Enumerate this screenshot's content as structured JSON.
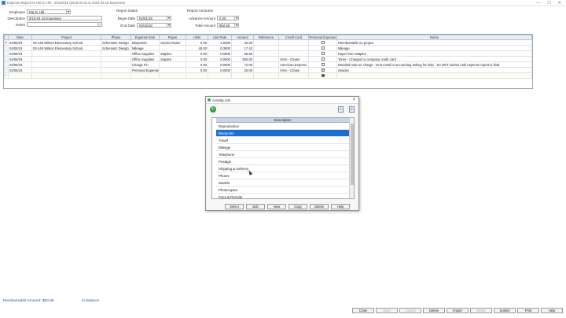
{
  "window": {
    "title": "Expense Report for Pat D. Hill - 4/15/2018 (2018-04-01 to 2018-04-15 Expenses)",
    "controls": [
      "—",
      "☐",
      "✕"
    ]
  },
  "header": {
    "employee_label": "Employee",
    "employee_value": "Pat D. Hill",
    "description_label": "Description",
    "description_value": "0/15-04-15 Expenses",
    "notes_label": "Notes",
    "notes_value": "",
    "report_dates_title": "Report Dates",
    "begin_date_label": "Begin Date",
    "begin_date_value": "04/01/18",
    "end_date_label": "End Date",
    "end_date_value": "04/15/18",
    "report_amounts_title": "Report Amounts",
    "advance_amount_label": "Advance Amount",
    "advance_amount_value": "0.00",
    "total_amount_label": "Total Amount",
    "total_amount_value": "952.56"
  },
  "grid": {
    "columns": [
      "Date",
      "Project",
      "Phase",
      "Expense Item",
      "Payee",
      "Units",
      "Unit Rate",
      "Amount",
      "Reference",
      "Credit Card",
      "Personal Expense",
      "Notes"
    ],
    "rows": [
      {
        "marker": "▸",
        "date": "04/05/18",
        "project": "03-145 Wilson Elementary School",
        "phase": "Schematic Design",
        "item": "Blueprints",
        "payee": "Vendor Name",
        "units": "0.00",
        "rate": "1.5000",
        "amount": "30.00",
        "reference": "",
        "card": "",
        "personal": "unchecked",
        "notes": "Reimbursable on project"
      },
      {
        "marker": "",
        "date": "04/05/18",
        "project": "03-145 Wilson Elementary School",
        "phase": "Schematic Design",
        "item": "Mileage",
        "payee": "",
        "units": "45.00",
        "rate": "0.3800",
        "amount": "17.10",
        "reference": "",
        "card": "",
        "personal": "unchecked",
        "notes": "Mileage"
      },
      {
        "marker": "",
        "date": "04/05/18",
        "project": "",
        "phase": "",
        "item": "Office Supplies",
        "payee": "Staples",
        "units": "0.00",
        "rate": "0.0000",
        "amount": "58.56",
        "reference": "",
        "card": "",
        "personal": "unchecked",
        "notes": "Paper from Staples"
      },
      {
        "marker": "",
        "date": "04/05/18",
        "project": "",
        "phase": "",
        "item": "Office Supplies",
        "payee": "Staples",
        "units": "0.00",
        "rate": "0.0000",
        "amount": "350.00",
        "reference": "",
        "card": "VISA - Chase",
        "personal": "unchecked",
        "notes": "Toner - Charged to company credit card"
      },
      {
        "marker": "",
        "date": "04/05/18",
        "project": "",
        "phase": "",
        "item": "Charge Fin",
        "payee": "",
        "units": "0.00",
        "rate": "0.0000",
        "amount": "72.00",
        "reference": "",
        "card": "American Express",
        "personal": "unchecked",
        "notes": "Detailed note on charge - sent email to accounting asking for help - Do NOT submit until expense report is final"
      },
      {
        "marker": "",
        "date": "04/05/18",
        "project": "",
        "phase": "",
        "item": "Personal Expense",
        "payee": "",
        "units": "0.00",
        "rate": "0.0000",
        "amount": "20.00",
        "reference": "",
        "card": "VISA - Chase",
        "personal": "checked",
        "notes": "Snacks"
      },
      {
        "marker": "*",
        "date": "",
        "project": "",
        "phase": "",
        "item": "",
        "payee": "",
        "units": "",
        "rate": "",
        "amount": "",
        "reference": "",
        "card": "",
        "personal": "filled",
        "notes": ""
      }
    ]
  },
  "status": {
    "reimbursable": "Reimbursable Amount: $60.86",
    "balance": "In balance"
  },
  "bottom_buttons": [
    {
      "label": "Close",
      "enabled": true
    },
    {
      "label": "Save",
      "enabled": false
    },
    {
      "label": "Cancel",
      "enabled": false
    },
    {
      "label": "Delete",
      "enabled": true
    },
    {
      "label": "Import",
      "enabled": true
    },
    {
      "label": "Reset",
      "enabled": false
    },
    {
      "label": "Submit",
      "enabled": true
    },
    {
      "label": "Print",
      "enabled": true
    },
    {
      "label": "Help",
      "enabled": true
    }
  ],
  "dialog": {
    "title": "Activity List",
    "column_header": "Description",
    "items": [
      "Reproduction",
      "Blueprints",
      "Travel",
      "Mileage",
      "Telephone",
      "Postage",
      "Shipping & Delivery",
      "Photos",
      "Models",
      "Photocopies",
      "Fees & Permits"
    ],
    "selected_index": 1,
    "buttons": [
      "Select",
      "Edit",
      "New",
      "Copy",
      "Delete",
      "Help"
    ]
  },
  "colors": {
    "selection": "#1c6fd1",
    "status_text": "#2b4fbf",
    "grid_header": "#e8eef7"
  }
}
